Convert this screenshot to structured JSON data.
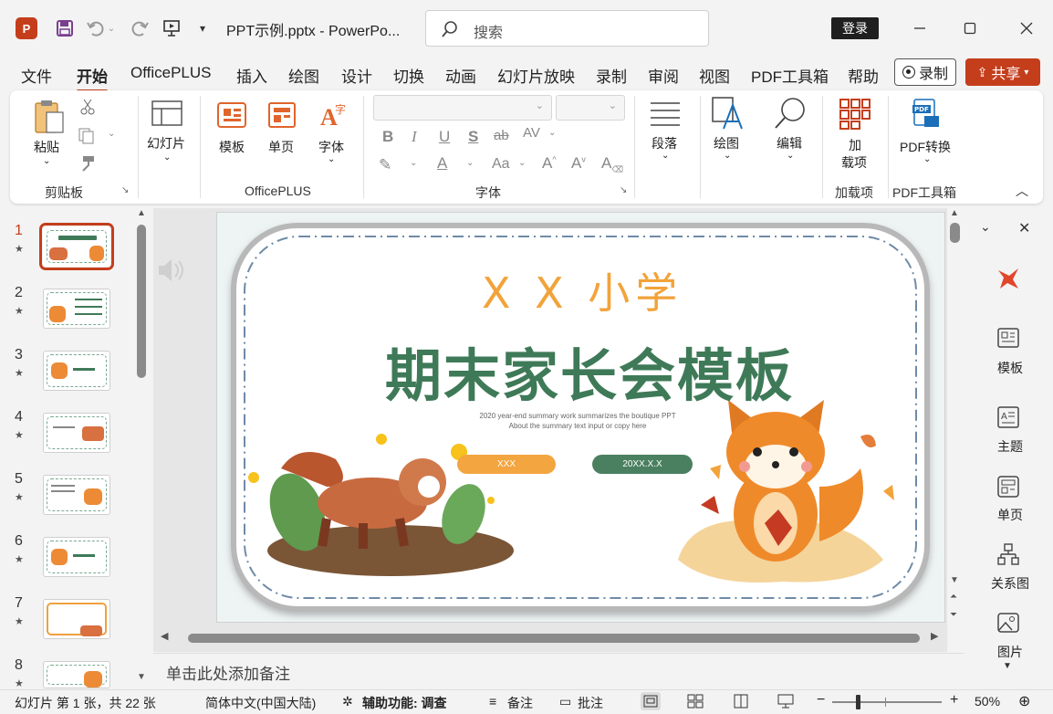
{
  "titlebar": {
    "doc_title": "PPT示例.pptx  -  PowerPo...",
    "search_placeholder": "搜索",
    "login": "登录"
  },
  "menu": {
    "tabs": [
      "文件",
      "开始",
      "OfficePLUS",
      "插入",
      "绘图",
      "设计",
      "切换",
      "动画",
      "幻灯片放映",
      "录制",
      "审阅",
      "视图",
      "PDF工具箱",
      "帮助"
    ],
    "active_tab": "开始",
    "record": "录制",
    "share": "共享"
  },
  "ribbon": {
    "paste": "粘贴",
    "clipboard_group": "剪贴板",
    "slides": "幻灯片",
    "template": "模板",
    "single_page": "单页",
    "font_btn": "字体",
    "officeplus_group": "OfficePLUS",
    "font_group": "字体",
    "paragraph": "段落",
    "drawing": "绘图",
    "edit": "编辑",
    "addin_line1": "加",
    "addin_line2": "载项",
    "addin_group": "加载项",
    "pdf_convert": "PDF转换",
    "pdf_group": "PDF工具箱"
  },
  "thumbnails": {
    "numbers": [
      "1",
      "2",
      "3",
      "4",
      "5",
      "6",
      "7",
      "8"
    ],
    "active_index": 0
  },
  "slide": {
    "school": "X  X 小学",
    "title": "期末家长会模板",
    "subtitle_line1": "2020 year-end summary work summarizes the boutique PPT",
    "subtitle_line2": "About the summary text input or copy here",
    "badge_left": "XXX",
    "badge_right": "20XX.X.X",
    "colors": {
      "title": "#3f7a58",
      "school": "#f2a33a",
      "badge_orange": "#f3a53f",
      "badge_green": "#4a8060"
    }
  },
  "notes_placeholder": "单击此处添加备注",
  "right_panel": {
    "items": [
      "模板",
      "主题",
      "单页",
      "关系图",
      "图片"
    ]
  },
  "status": {
    "slide_info": "幻灯片 第 1 张，共 22 张",
    "language": "简体中文(中国大陆)",
    "accessibility": "辅助功能: 调查",
    "notes": "备注",
    "comments": "批注",
    "zoom": "50%"
  }
}
